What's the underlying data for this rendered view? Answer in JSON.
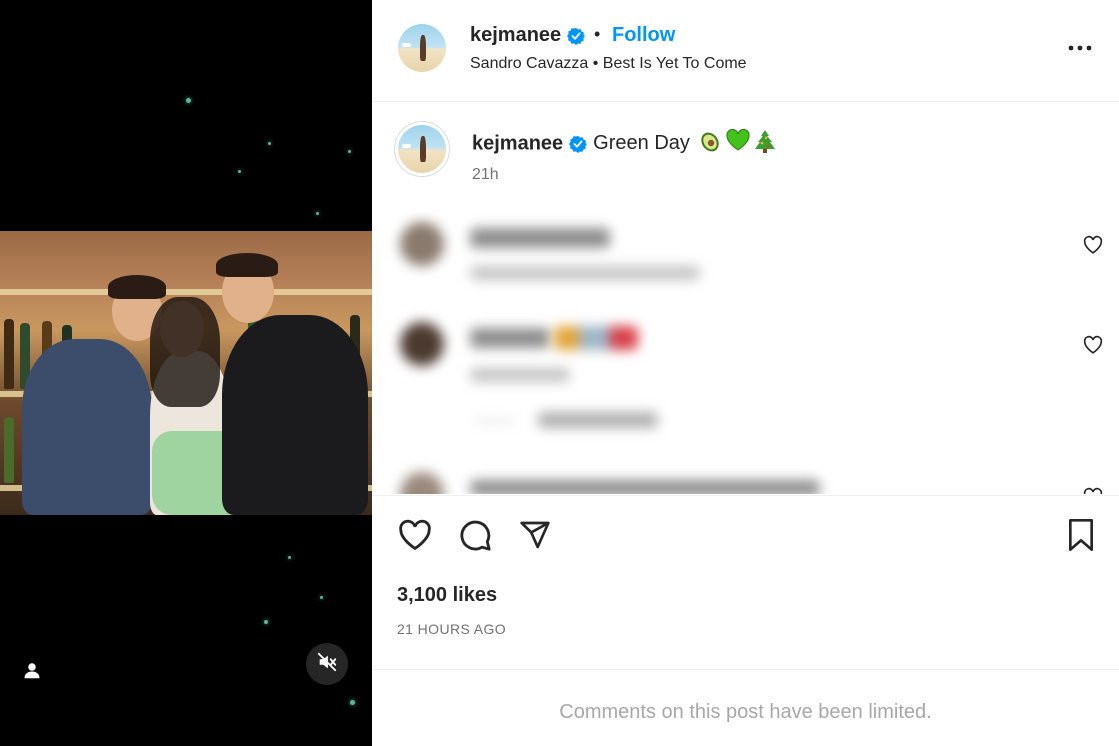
{
  "post": {
    "username": "kejmanee",
    "follow_label": "Follow",
    "separator": "•",
    "audio": "Sandro Cavazza • Best Is Yet To Come",
    "caption_text": "Green Day",
    "caption_emojis": [
      "avocado",
      "green-heart",
      "christmas-tree"
    ],
    "caption_time": "21h",
    "likes": "3,100 likes",
    "posted_ago": "21 HOURS AGO",
    "comments_notice": "Comments on this post have been limited."
  },
  "colors": {
    "accent": "#0095f6",
    "verified": "#0095f6",
    "text": "#262626",
    "muted": "#737373",
    "media_bg": "#000000"
  },
  "icons": {
    "media": [
      "user-tag-icon",
      "volume-muted-icon"
    ],
    "header": [
      "verified-icon",
      "more-options-icon"
    ],
    "actions": [
      "heart-icon",
      "comment-icon",
      "share-icon",
      "bookmark-icon"
    ]
  }
}
